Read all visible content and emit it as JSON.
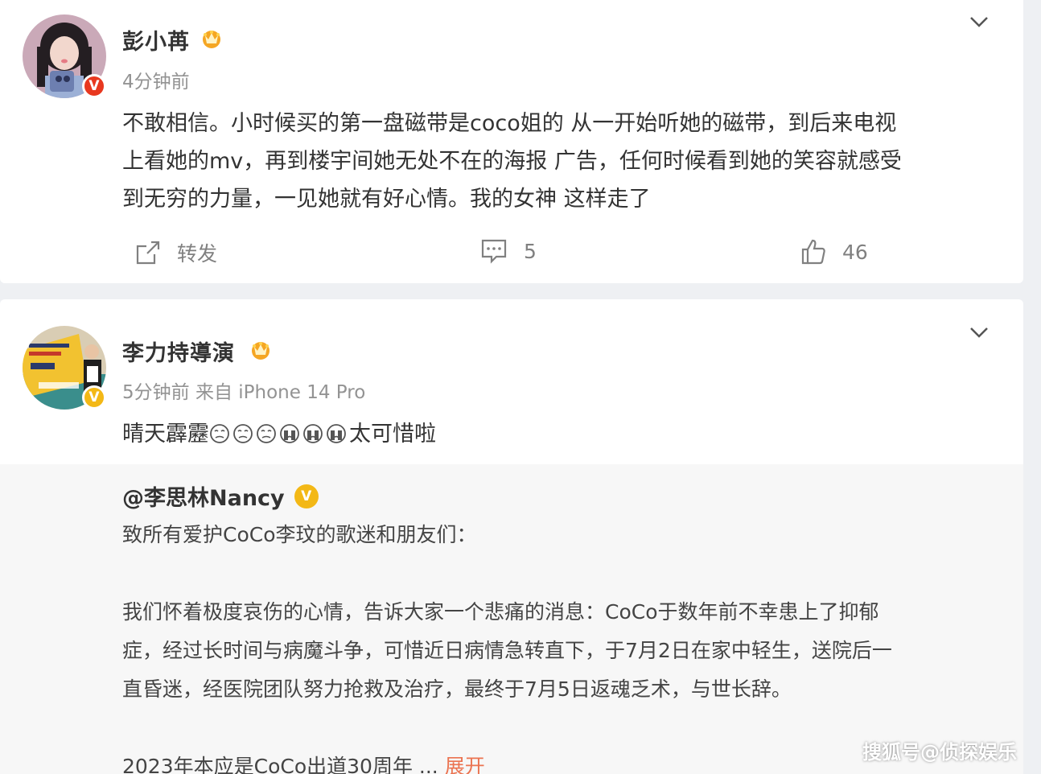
{
  "post1": {
    "author": "彭小苒",
    "time": "4分钟前",
    "text_lines": [
      "不敢相信。小时候买的第一盘磁带是coco姐的 从一开始听她的磁带，到后来电视",
      "上看她的mv，再到楼宇间她无处不在的海报 广告，任何时候看到她的笑容就感受",
      "到无穷的力量，一见她就有好心情。我的女神 这样走了"
    ],
    "repost_label": "转发",
    "comment_count": "5",
    "like_count": "46",
    "badge": "V"
  },
  "post2": {
    "author": "李力持導演",
    "meta": "5分钟前  来自 iPhone 14 Pro",
    "text_prefix": "晴天霹靂",
    "text_suffix": "太可惜啦",
    "badge": "V"
  },
  "repost": {
    "author": "@李思林Nancy",
    "verified": "V",
    "line1": "致所有爱护CoCo李玟的歌迷和朋友们：",
    "para_lines": [
      "我们怀着极度哀伤的心情，告诉大家一个悲痛的消息：CoCo于数年前不幸患上了抑郁",
      "症，经过长时间与病魔斗争，可惜近日病情急转直下，于7月2日在家中轻生，送院后一",
      "直昏迷，经医院团队努力抢救及治疗，最终于7月5日返魂乏术，与世长辞。"
    ],
    "last_line": "2023年本应是CoCo出道30周年  ...",
    "expand_label": "展开"
  },
  "watermark": "搜狐号@侦探娱乐",
  "colors": {
    "accent": "#eb7350",
    "badge_red": "#e8381f",
    "badge_gold": "#f3b816",
    "vip": "#f5a623"
  }
}
